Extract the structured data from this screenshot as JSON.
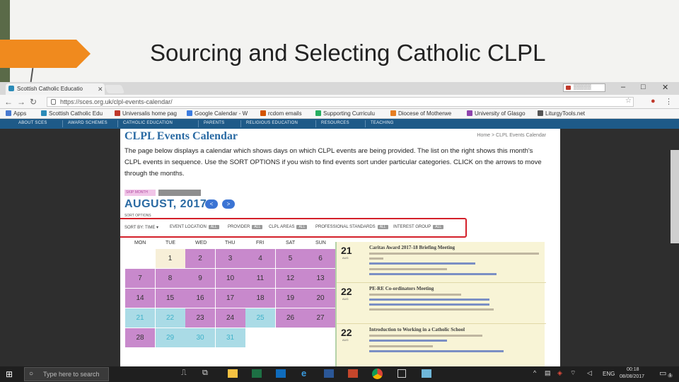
{
  "slide": {
    "title": "Sourcing and Selecting Catholic CLPL"
  },
  "browser": {
    "tab_title": "Scottish Catholic Educatio",
    "url": "https://sces.org.uk/clpl-events-calendar/",
    "bookmarks": [
      "Apps",
      "Scottish Catholic Edu",
      "Universalis home pag",
      "Google Calendar - W",
      "rcdom emails",
      "Supporting Curriculu",
      "Diocese of Motherwe",
      "University of Glasgo",
      "LiturgyTools.net"
    ]
  },
  "site_nav": [
    "ABOUT SCES",
    "AWARD SCHEMES",
    "CATHOLIC EDUCATION",
    "PARENTS",
    "RELIGIOUS EDUCATION",
    "RESOURCES",
    "TEACHING"
  ],
  "page": {
    "title": "CLPL Events Calendar",
    "breadcrumb": "Home > CLPL Events Calendar",
    "intro": "The page below displays a calendar which shows days on which CLPL events are being provided. The list on the right shows this month's CLPL events in sequence. Use the SORT OPTIONS if you wish to find events sort under particular categories. CLICK on the arrows to move through the months.",
    "skip_label": "SKIP MONTH",
    "month": "AUGUST, 2017",
    "prev": "<",
    "next": ">",
    "sort_options_label": "SORT OPTIONS",
    "sort_row": {
      "sort_by": "SORT BY: TIME",
      "event_location": "EVENT LOCATION",
      "provider": "PROVIDER",
      "clpl_areas": "CLPL AREAS",
      "professional_standards": "PROFESSIONAL STANDARDS",
      "interest_group": "INTEREST GROUP",
      "all": "ALL"
    }
  },
  "calendar": {
    "weekdays": [
      "MON",
      "TUE",
      "WED",
      "THU",
      "FRI",
      "SAT",
      "SUN"
    ],
    "weeks": [
      [
        "",
        "1",
        "2",
        "3",
        "4",
        "5",
        "6"
      ],
      [
        "7",
        "8",
        "9",
        "10",
        "11",
        "12",
        "13"
      ],
      [
        "14",
        "15",
        "16",
        "17",
        "18",
        "19",
        "20"
      ],
      [
        "21",
        "22",
        "23",
        "24",
        "25",
        "26",
        "27"
      ],
      [
        "28",
        "29",
        "30",
        "31",
        "",
        "",
        ""
      ]
    ],
    "colors": {
      "default": "#c889cc",
      "today": "#f7efd8",
      "event": "#aadbe6",
      "event_text": "#3fb2c9"
    }
  },
  "events": [
    {
      "day": "21",
      "mon": "AUG",
      "title": "Caritas Award 2017-18 Briefing Meeting"
    },
    {
      "day": "22",
      "mon": "AUG",
      "title": "PE-RE Co-ordinators Meeting"
    },
    {
      "day": "22",
      "mon": "AUG",
      "title": "Introduction to Working in a Catholic School"
    }
  ],
  "taskbar": {
    "search_placeholder": "Type here to search",
    "lang": "ENG",
    "time": "00:18",
    "date": "08/08/2017",
    "notif_count": "1"
  }
}
